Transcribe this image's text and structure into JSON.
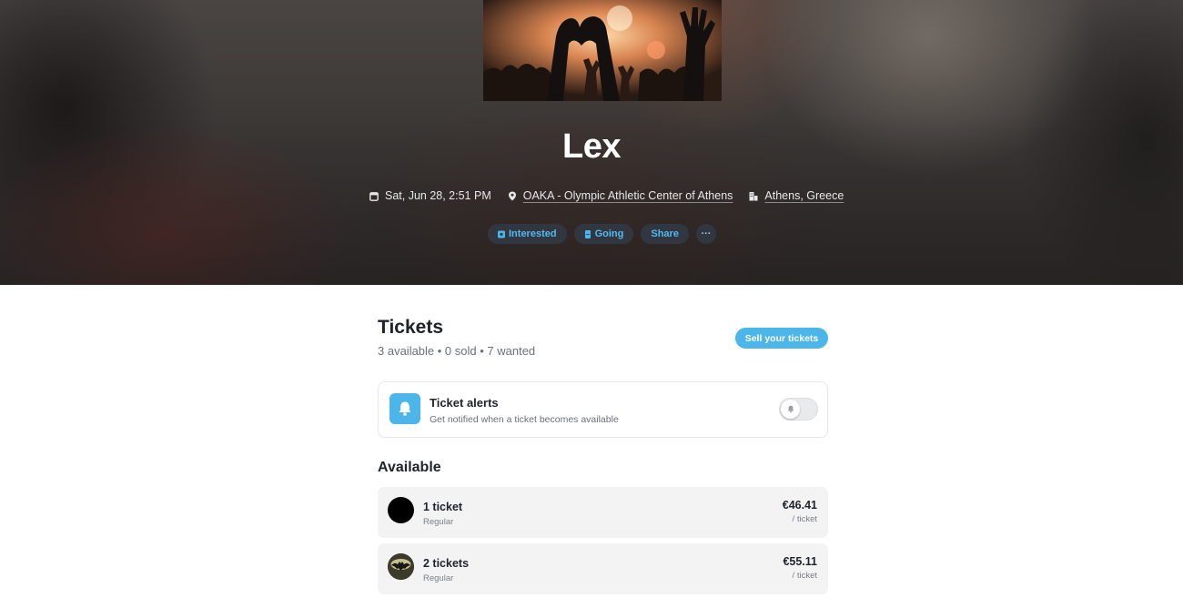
{
  "event": {
    "title": "Lex",
    "date_time": "Sat, Jun 28, 2:51 PM",
    "venue": "OAKA - Olympic Athletic Center of Athens",
    "city": "Athens, Greece",
    "cover_image": "concert-crowd-heart-hands"
  },
  "actions": {
    "interested_label": "Interested",
    "going_label": "Going",
    "share_label": "Share",
    "more_label": "···"
  },
  "tickets": {
    "heading": "Tickets",
    "stats": "3 available • 0 sold • 7 wanted",
    "sell_label": "Sell your tickets"
  },
  "alerts": {
    "title": "Ticket alerts",
    "subtitle": "Get notified when a ticket becomes available",
    "enabled": false
  },
  "available": {
    "heading": "Available",
    "listings": [
      {
        "quantity": "1 ticket",
        "type": "Regular",
        "price": "€46.41",
        "unit": "/ ticket",
        "avatar": "black-circle"
      },
      {
        "quantity": "2 tickets",
        "type": "Regular",
        "price": "€55.11",
        "unit": "/ ticket",
        "avatar": "bat-logo"
      }
    ]
  },
  "colors": {
    "accent": "#4cb5ea",
    "text": "#1f2329",
    "muted": "#6b6f76",
    "card_bg": "#f3f3f4"
  }
}
